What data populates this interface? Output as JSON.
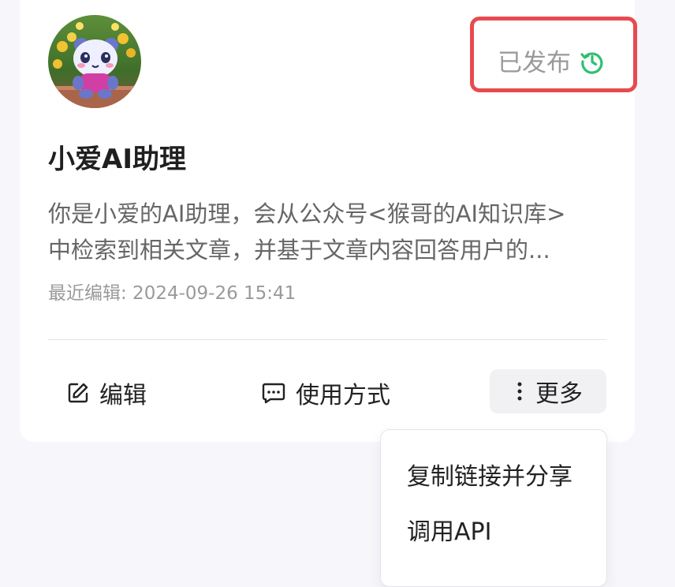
{
  "card": {
    "status": "已发布",
    "status_icon": "history-icon",
    "title": "小爱AI助理",
    "description_line1": "你是小爱的AI助理，会从公众号<猴哥的AI知识库>",
    "description_line2": "中检索到相关文章，并基于文章内容回答用户的...",
    "last_edited": "最近编辑: 2024-09-26 15:41"
  },
  "actions": {
    "edit_label": "编辑",
    "usage_label": "使用方式",
    "more_label": "更多"
  },
  "more_menu": {
    "items": [
      {
        "label": "复制链接并分享"
      },
      {
        "label": "调用API"
      }
    ]
  },
  "colors": {
    "status_icon": "#2fbf71",
    "highlight_box": "#e84a4f"
  }
}
